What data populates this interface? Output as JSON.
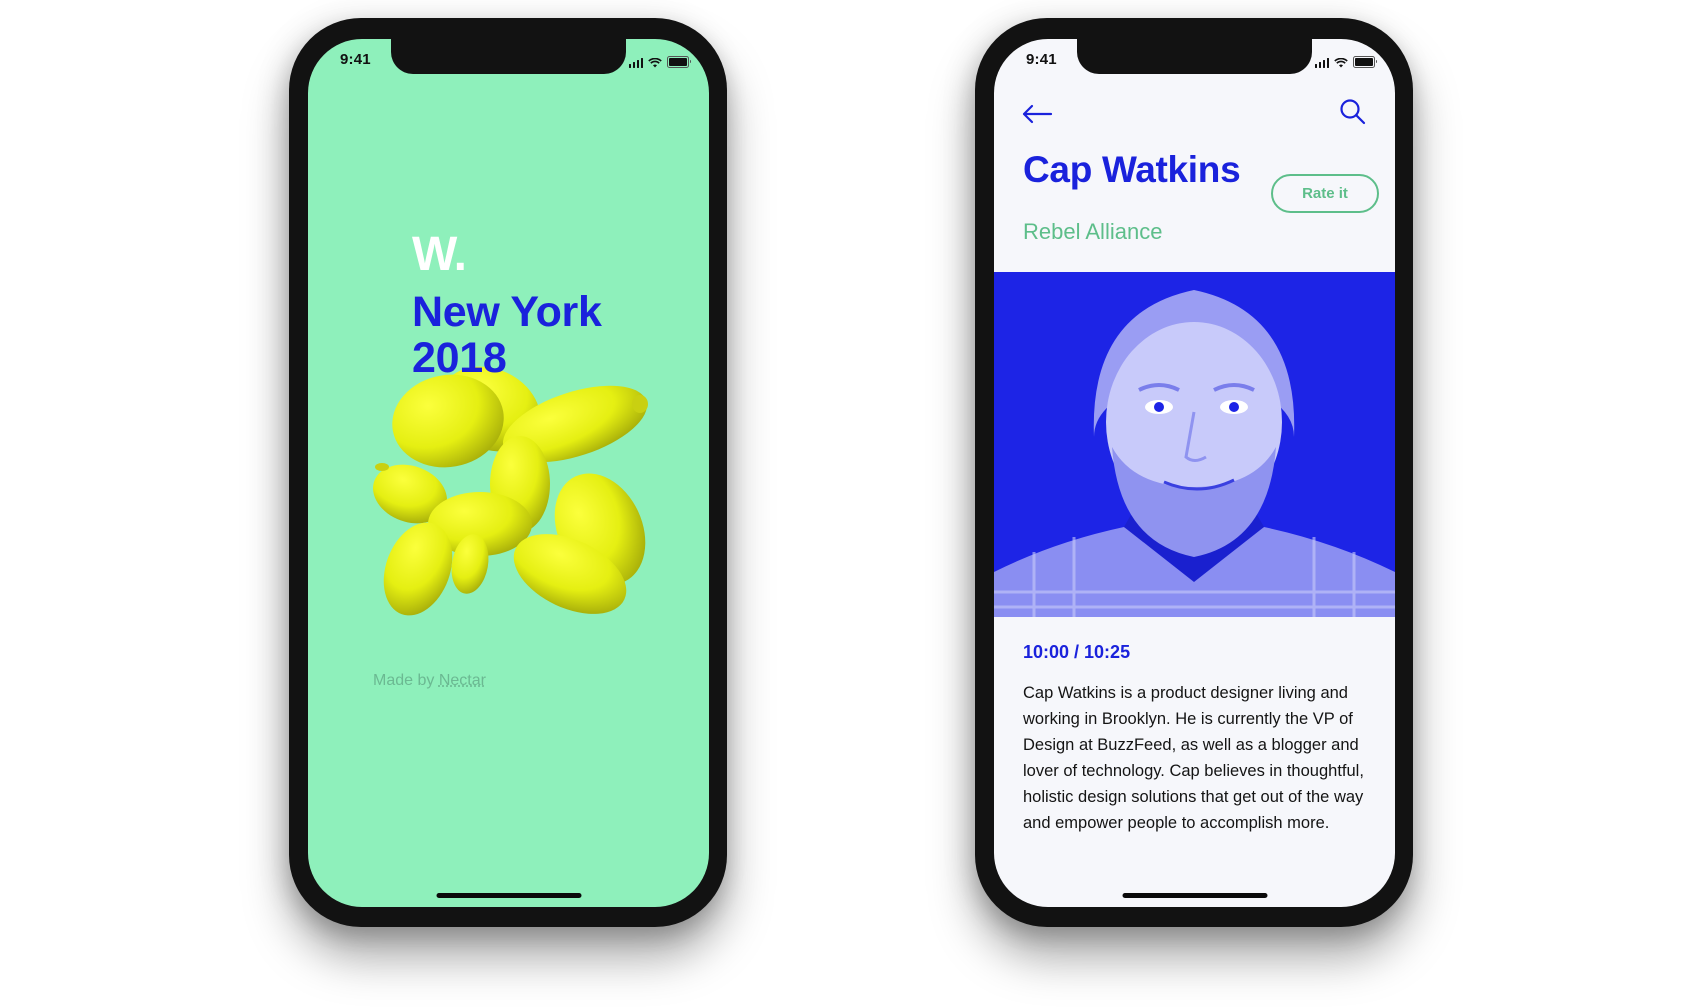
{
  "left_phone": {
    "status_bar": {
      "time": "9:41",
      "icons": [
        "signal-icon",
        "wifi-icon",
        "battery-icon"
      ]
    },
    "logo": "W.",
    "event_city": "New York",
    "event_year": "2018",
    "illustration": "balloon-dog",
    "credit": {
      "prefix": "Made by ",
      "link": "Nectar"
    },
    "colors": {
      "background": "#8ef0bb",
      "accent": "#1a22dc",
      "balloon": "#e8f21a"
    }
  },
  "right_phone": {
    "status_bar": {
      "time": "9:41",
      "icons": [
        "signal-icon",
        "wifi-icon",
        "battery-icon"
      ]
    },
    "nav": {
      "back_icon": "arrow-left-icon",
      "search_icon": "search-icon"
    },
    "speaker": {
      "name": "Cap Watkins",
      "company": "Rebel Alliance",
      "rate_label": "Rate it",
      "photo": "speaker-portrait"
    },
    "session_time": "10:00 / 10:25",
    "bio": "Cap Watkins is a product designer living and working in Brooklyn. He is currently the VP of Design at BuzzFeed, as well as a blogger and lover of technology. Cap believes in thoughtful, holistic design solutions that get out of the way and empower people to accomplish more.",
    "colors": {
      "background": "#f6f7fb",
      "accent": "#1a22dc",
      "secondary": "#5dbe8a",
      "photo_tint": "#1d24e6"
    }
  }
}
